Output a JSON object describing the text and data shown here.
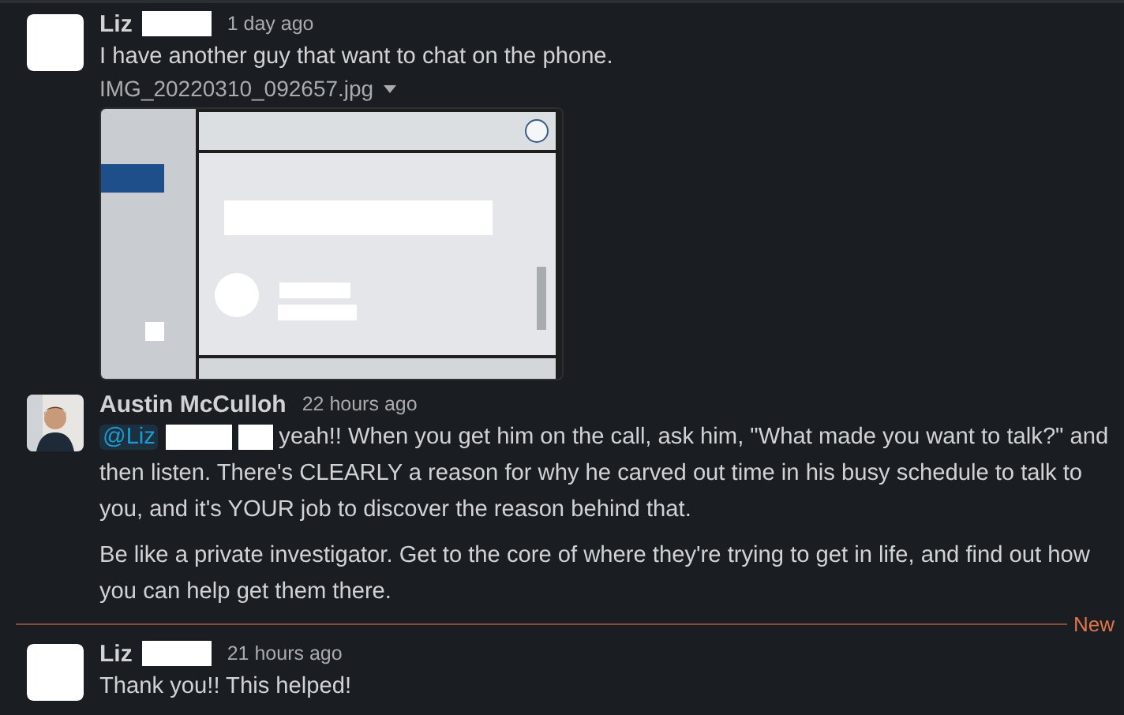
{
  "feed": [
    {
      "kind": "message",
      "author": "Liz",
      "name_redacted": true,
      "time": "1 day ago",
      "avatar_photo": false,
      "paragraphs": [
        "I have another guy that want to chat on the phone."
      ],
      "attachment": {
        "filename": "IMG_20220310_092657.jpg",
        "kind": "picture"
      }
    },
    {
      "kind": "message",
      "author": "Austin McCulloh",
      "name_redacted": false,
      "time": "22 hours ago",
      "avatar_photo": true,
      "mention": "@Liz",
      "paragraphs": [
        "yeah!! When you get him on the call, ask him, \"What made you want to talk?\" and then listen. There's CLEARLY a reason for why he carved out time in his busy schedule to talk to you, and it's YOUR job to discover the reason behind that.",
        "Be like a private investigator. Get to the core of where they're trying to get in life, and find out how you can help get them there."
      ]
    },
    {
      "kind": "divider",
      "label": "New"
    },
    {
      "kind": "message",
      "author": "Liz",
      "name_redacted": true,
      "time": "21 hours ago",
      "avatar_photo": false,
      "paragraphs": [
        "Thank you!! This helped!"
      ]
    }
  ]
}
